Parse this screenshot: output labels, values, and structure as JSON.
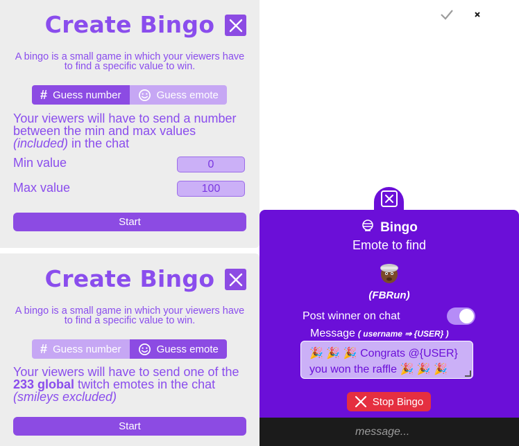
{
  "top_panel": {
    "title": "Create Bingo",
    "description": "A bingo is a small game in which your viewers have to find a specific value to win.",
    "tabs": [
      {
        "label": "Guess number",
        "icon": "hash-icon",
        "active": true
      },
      {
        "label": "Guess emote",
        "icon": "smiley-icon",
        "active": false
      }
    ],
    "info_line1": "Your viewers will have to send a number between the min and max values ",
    "info_italic": "(included)",
    "info_end": " in the chat",
    "min_label": "Min value",
    "min_value": "0",
    "max_label": "Max value",
    "max_value": "100",
    "start_label": "Start"
  },
  "bottom_panel": {
    "title": "Create Bingo",
    "description": "A bingo is a small game in which your viewers have to find a specific value to win.",
    "tabs": [
      {
        "label": "Guess number",
        "icon": "hash-icon",
        "active": false
      },
      {
        "label": "Guess emote",
        "icon": "smiley-icon",
        "active": true
      }
    ],
    "info_prefix": "Your viewers will have to send one of the ",
    "info_bold": "233 global",
    "info_mid": " twitch emotes in the chat ",
    "info_italic": "(smileys excluded)",
    "start_label": "Start"
  },
  "widget": {
    "title": "Bingo",
    "subtitle": "Emote to find",
    "emote_name": "(FBRun)",
    "post_winner_label": "Post winner on chat",
    "post_winner_enabled": true,
    "message_label": "Message",
    "message_hint": "( username ⇒ {USER} )",
    "message_value": "Congrats @{USER} you won the raffle",
    "stop_label": "Stop Bingo"
  },
  "chatbar": {
    "placeholder": "message..."
  },
  "colors": {
    "accent": "#8c4be3",
    "accent_light": "#c6a7f4",
    "widget_bg": "#6b0fd8",
    "danger": "#e52f40",
    "panel_bg": "#ededed",
    "chatbar_bg": "#1b1b1b"
  }
}
